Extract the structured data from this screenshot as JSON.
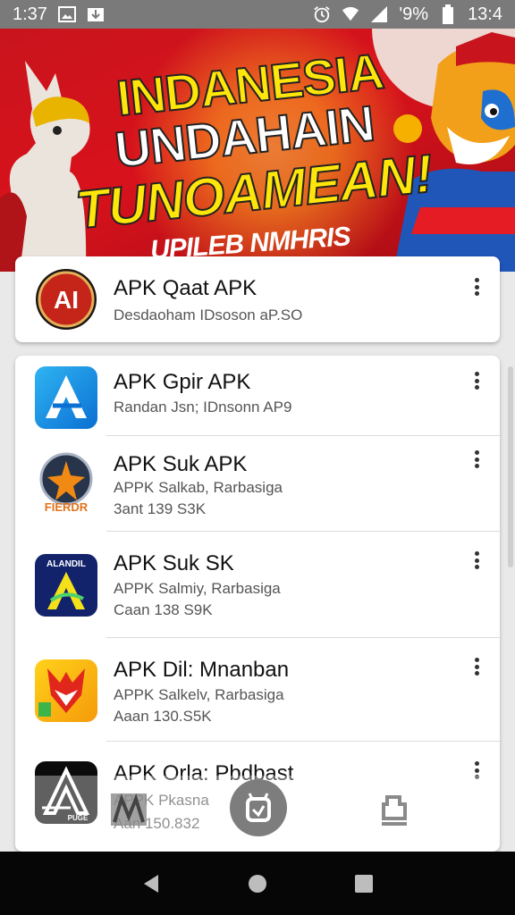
{
  "status_bar": {
    "time_left": "1:37",
    "battery": "'9%",
    "time_right": "13:4"
  },
  "banner": {
    "line1": "INDANESIA",
    "line2": "UNDAHAIN",
    "line3": "TUNOAMEAN!",
    "line4": "UPILEB NMHRIS"
  },
  "featured": {
    "title": "APK Qaat APK",
    "subtitle": "Desdaoham IDsoson aP.SO",
    "icon_text": "AI"
  },
  "apps": [
    {
      "title": "APK Gpir APK",
      "line1": "Randan Jsn; IDnsonn AP9",
      "line2": "",
      "icon": "blue-a-icon"
    },
    {
      "title": "APK Suk APK",
      "line1": "APPK Salkab, Rarbasiga",
      "line2": "3ant 139 S3K",
      "icon": "star-badge-icon",
      "icon_text": "FIERDR"
    },
    {
      "title": "APK Suk SK",
      "line1": "APPK Salmiy, Rarbasiga",
      "line2": "Caan 138 S9K",
      "icon": "navy-a-icon",
      "icon_text": "ALANDIL"
    },
    {
      "title": "APK Dil: Mnanban",
      "line1": "APPK Salkelv, Rarbasiga",
      "line2": "Aaan 130.S5K",
      "icon": "colorful-fox-icon"
    },
    {
      "title": "APK Orla: Pbdbast",
      "line1": "APPK Pkasna",
      "line2": "Aan 150.832",
      "icon": "black-a-icon",
      "icon_text": "PUGE"
    }
  ],
  "colors": {
    "banner_red": "#d8121c",
    "banner_yellow": "#ffe60a",
    "status_bar": "#7a7a7a"
  }
}
